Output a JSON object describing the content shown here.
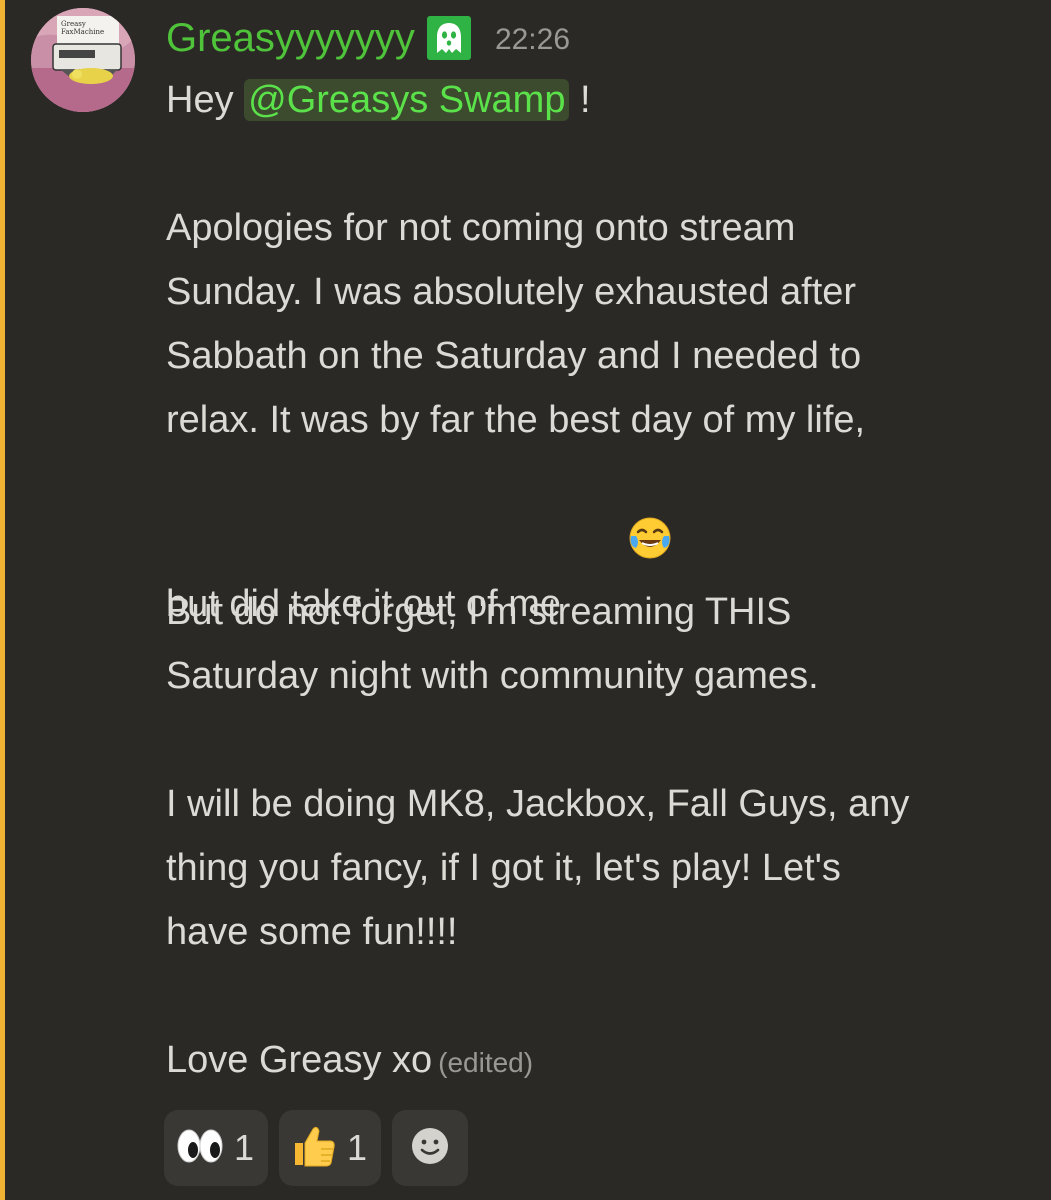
{
  "message": {
    "author": "Greasyyyyyyy",
    "timestamp": "22:26",
    "avatar_text": "Greasy FaxMachine",
    "lines": [
      {
        "pre": "Hey ",
        "mention": "@Greasys Swamp",
        "post": " !"
      },
      "",
      "Apologies for not coming onto stream",
      "Sunday. I was absolutely exhausted after",
      "Sabbath on the Saturday and I needed to",
      "relax. It was by far the best day of my life,",
      "but did take it out of me",
      "",
      "But do not forget, I'm streaming THIS",
      "Saturday night with community games.",
      "",
      "I will be doing MK8, Jackbox, Fall Guys, any",
      "thing you fancy, if I got it, let's play! Let's",
      "have some fun!!!!",
      "",
      "Love Greasy xo"
    ],
    "edited_label": "(edited)",
    "inline_emoji": "face-with-tears-of-joy"
  },
  "reactions": [
    {
      "emoji": "eyes",
      "count": "1"
    },
    {
      "emoji": "thumbs-up",
      "count": "1"
    }
  ],
  "colors": {
    "background": "#2b2926",
    "accent_bar": "#f0b232",
    "username": "#4fc33a",
    "mention_bg": "#3c4a2e",
    "mention_text": "#5be24a",
    "body_text": "#dcdad4",
    "muted": "#9a9892"
  }
}
